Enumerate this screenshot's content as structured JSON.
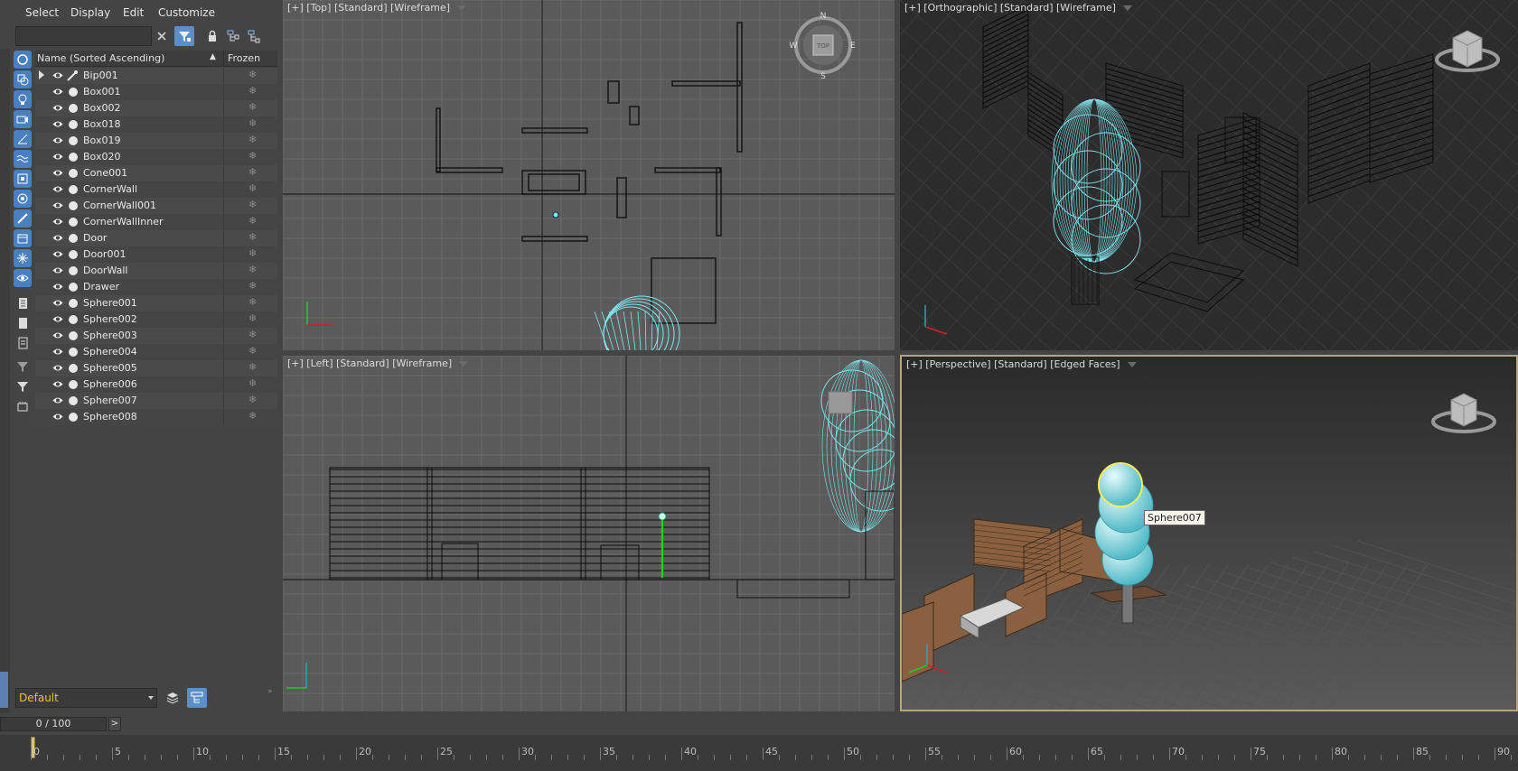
{
  "menu": [
    "Select",
    "Display",
    "Edit",
    "Customize"
  ],
  "explorer": {
    "search_placeholder": "",
    "header": {
      "name": "Name (Sorted Ascending)",
      "frozen": "Frozen"
    },
    "objects": [
      "Bip001",
      "Box001",
      "Box002",
      "Box018",
      "Box019",
      "Box020",
      "Cone001",
      "CornerWall",
      "CornerWall001",
      "CornerWallInner",
      "Door",
      "Door001",
      "DoorWall",
      "Drawer",
      "Sphere001",
      "Sphere002",
      "Sphere003",
      "Sphere004",
      "Sphere005",
      "Sphere006",
      "Sphere007",
      "Sphere008"
    ],
    "frozen_glyph": "❄",
    "layer": "Default",
    "collapse_glyph": "»"
  },
  "viewports": {
    "top": {
      "label": "[+] [Top] [Standard] [Wireframe]",
      "compass": {
        "n": "N",
        "s": "S",
        "e": "E",
        "w": "W",
        "cube": "TOP"
      }
    },
    "ortho": {
      "label": "[+] [Orthographic] [Standard] [Wireframe]"
    },
    "left": {
      "label": "[+] [Left] [Standard] [Wireframe]"
    },
    "persp": {
      "label": "[+] [Perspective] [Standard] [Edged Faces]",
      "tooltip": "Sphere007"
    }
  },
  "timeline": {
    "slider": "0 / 100",
    "next": ">",
    "ticks": [
      "0",
      "5",
      "10",
      "15",
      "20",
      "25",
      "30",
      "35",
      "40",
      "45",
      "50",
      "55",
      "60",
      "65",
      "70",
      "75",
      "80",
      "85",
      "90"
    ],
    "frame_current": 0
  },
  "colors": {
    "accent": "#5b8fc9",
    "layer_text": "#e8c33a",
    "wire_cyan": "#7ee6ee",
    "active_border": "#b8a678"
  }
}
